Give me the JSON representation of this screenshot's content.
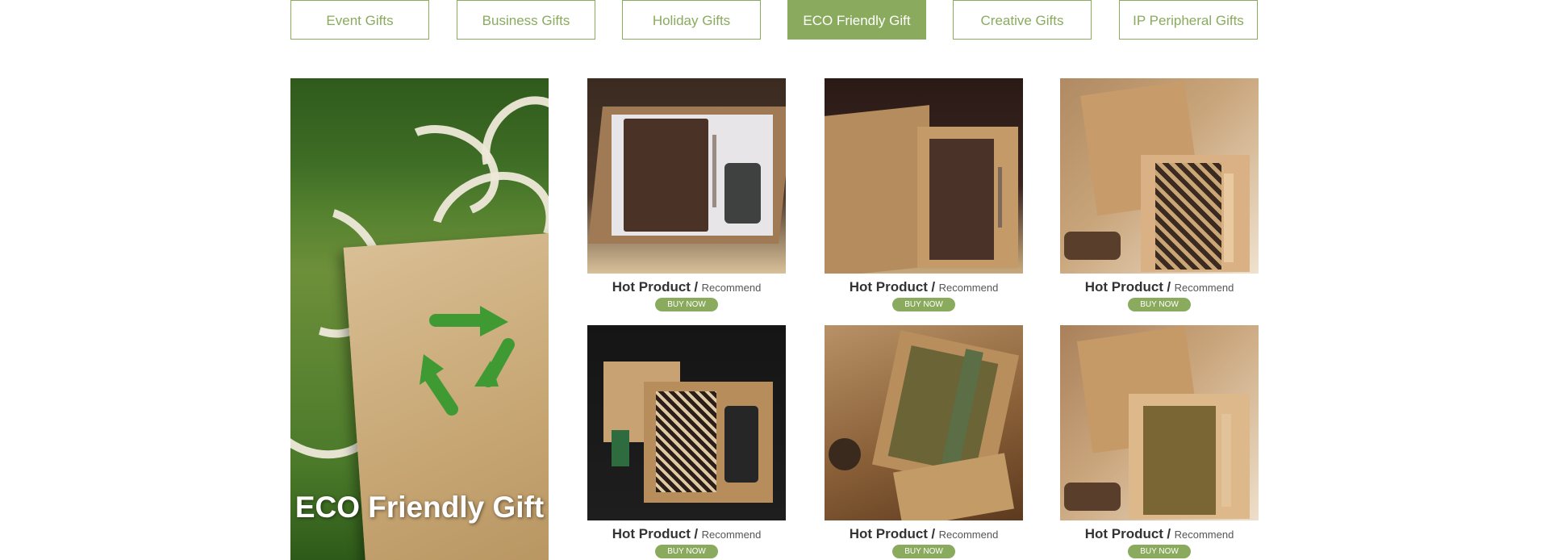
{
  "tabs": [
    {
      "label": "Event Gifts",
      "active": false
    },
    {
      "label": "Business Gifts",
      "active": false
    },
    {
      "label": "Holiday Gifts",
      "active": false
    },
    {
      "label": "ECO Friendly Gift",
      "active": true
    },
    {
      "label": "Creative Gifts",
      "active": false
    },
    {
      "label": "IP Peripheral Gifts",
      "active": false
    }
  ],
  "hero": {
    "title": "ECO Friendly Gift"
  },
  "products": [
    {
      "hot": "Hot Product",
      "sep": "/",
      "tag": "Recommend",
      "buy": "BUY NOW"
    },
    {
      "hot": "Hot Product",
      "sep": "/",
      "tag": "Recommend",
      "buy": "BUY NOW"
    },
    {
      "hot": "Hot Product",
      "sep": "/",
      "tag": "Recommend",
      "buy": "BUY NOW"
    },
    {
      "hot": "Hot Product",
      "sep": "/",
      "tag": "Recommend",
      "buy": "BUY NOW"
    },
    {
      "hot": "Hot Product",
      "sep": "/",
      "tag": "Recommend",
      "buy": "BUY NOW"
    },
    {
      "hot": "Hot Product",
      "sep": "/",
      "tag": "Recommend",
      "buy": "BUY NOW"
    }
  ],
  "colors": {
    "accent": "#8aab5e"
  }
}
